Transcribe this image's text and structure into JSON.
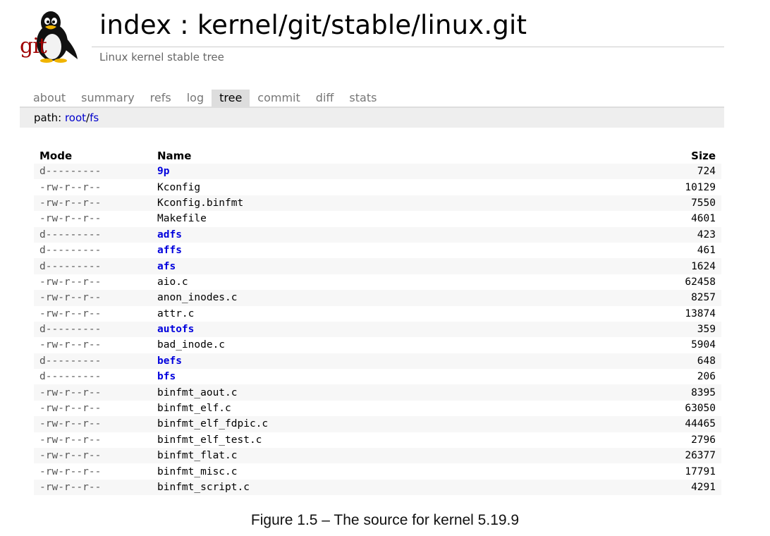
{
  "header": {
    "logo_text": "git",
    "title": "index : kernel/git/stable/linux.git",
    "subtitle": "Linux kernel stable tree"
  },
  "tabs": [
    {
      "label": "about",
      "active": false
    },
    {
      "label": "summary",
      "active": false
    },
    {
      "label": "refs",
      "active": false
    },
    {
      "label": "log",
      "active": false
    },
    {
      "label": "tree",
      "active": true
    },
    {
      "label": "commit",
      "active": false
    },
    {
      "label": "diff",
      "active": false
    },
    {
      "label": "stats",
      "active": false
    }
  ],
  "path": {
    "label": "path: ",
    "root": "root",
    "sep": "/",
    "dir": "fs"
  },
  "table": {
    "headers": {
      "mode": "Mode",
      "name": "Name",
      "size": "Size"
    },
    "rows": [
      {
        "mode": "d---------",
        "name": "9p",
        "size": "724",
        "dir": true
      },
      {
        "mode": "-rw-r--r--",
        "name": "Kconfig",
        "size": "10129",
        "dir": false
      },
      {
        "mode": "-rw-r--r--",
        "name": "Kconfig.binfmt",
        "size": "7550",
        "dir": false
      },
      {
        "mode": "-rw-r--r--",
        "name": "Makefile",
        "size": "4601",
        "dir": false
      },
      {
        "mode": "d---------",
        "name": "adfs",
        "size": "423",
        "dir": true
      },
      {
        "mode": "d---------",
        "name": "affs",
        "size": "461",
        "dir": true
      },
      {
        "mode": "d---------",
        "name": "afs",
        "size": "1624",
        "dir": true
      },
      {
        "mode": "-rw-r--r--",
        "name": "aio.c",
        "size": "62458",
        "dir": false
      },
      {
        "mode": "-rw-r--r--",
        "name": "anon_inodes.c",
        "size": "8257",
        "dir": false
      },
      {
        "mode": "-rw-r--r--",
        "name": "attr.c",
        "size": "13874",
        "dir": false
      },
      {
        "mode": "d---------",
        "name": "autofs",
        "size": "359",
        "dir": true
      },
      {
        "mode": "-rw-r--r--",
        "name": "bad_inode.c",
        "size": "5904",
        "dir": false
      },
      {
        "mode": "d---------",
        "name": "befs",
        "size": "648",
        "dir": true
      },
      {
        "mode": "d---------",
        "name": "bfs",
        "size": "206",
        "dir": true
      },
      {
        "mode": "-rw-r--r--",
        "name": "binfmt_aout.c",
        "size": "8395",
        "dir": false
      },
      {
        "mode": "-rw-r--r--",
        "name": "binfmt_elf.c",
        "size": "63050",
        "dir": false
      },
      {
        "mode": "-rw-r--r--",
        "name": "binfmt_elf_fdpic.c",
        "size": "44465",
        "dir": false
      },
      {
        "mode": "-rw-r--r--",
        "name": "binfmt_elf_test.c",
        "size": "2796",
        "dir": false
      },
      {
        "mode": "-rw-r--r--",
        "name": "binfmt_flat.c",
        "size": "26377",
        "dir": false
      },
      {
        "mode": "-rw-r--r--",
        "name": "binfmt_misc.c",
        "size": "17791",
        "dir": false
      },
      {
        "mode": "-rw-r--r--",
        "name": "binfmt_script.c",
        "size": "4291",
        "dir": false
      }
    ]
  },
  "caption": "Figure 1.5 – The source for kernel 5.19.9",
  "colors": {
    "link": "#0000cc",
    "dir_link": "#0000dd",
    "logo_red": "#a00000",
    "active_tab_bg": "#dddddd"
  }
}
